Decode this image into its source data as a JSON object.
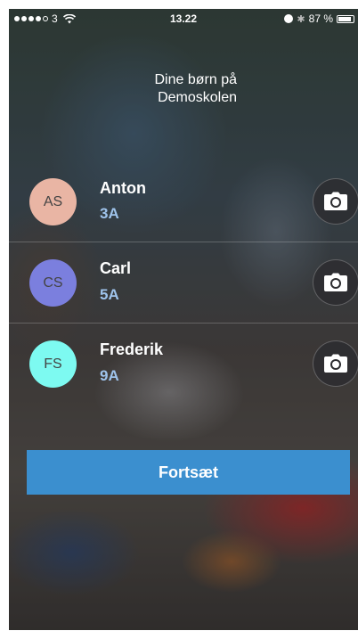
{
  "status_bar": {
    "carrier": "3",
    "time": "13.22",
    "battery": "87 %",
    "icons": [
      "signal-dots",
      "wifi-icon",
      "alarm-icon",
      "bluetooth-icon",
      "battery-icon"
    ]
  },
  "header": {
    "line1": "Dine børn på",
    "line2": "Demoskolen"
  },
  "children": [
    {
      "initials": "AS",
      "name": "Anton",
      "class": "3A",
      "avatar_color": "#e9b5a4"
    },
    {
      "initials": "CS",
      "name": "Carl",
      "class": "5A",
      "avatar_color": "#7b7fde"
    },
    {
      "initials": "FS",
      "name": "Frederik",
      "class": "9A",
      "avatar_color": "#7dfaf1"
    }
  ],
  "colors": {
    "continue_button": "#3b8fcf",
    "class_text": "#9fc4ec"
  },
  "continue_button": {
    "label": "Fortsæt"
  }
}
